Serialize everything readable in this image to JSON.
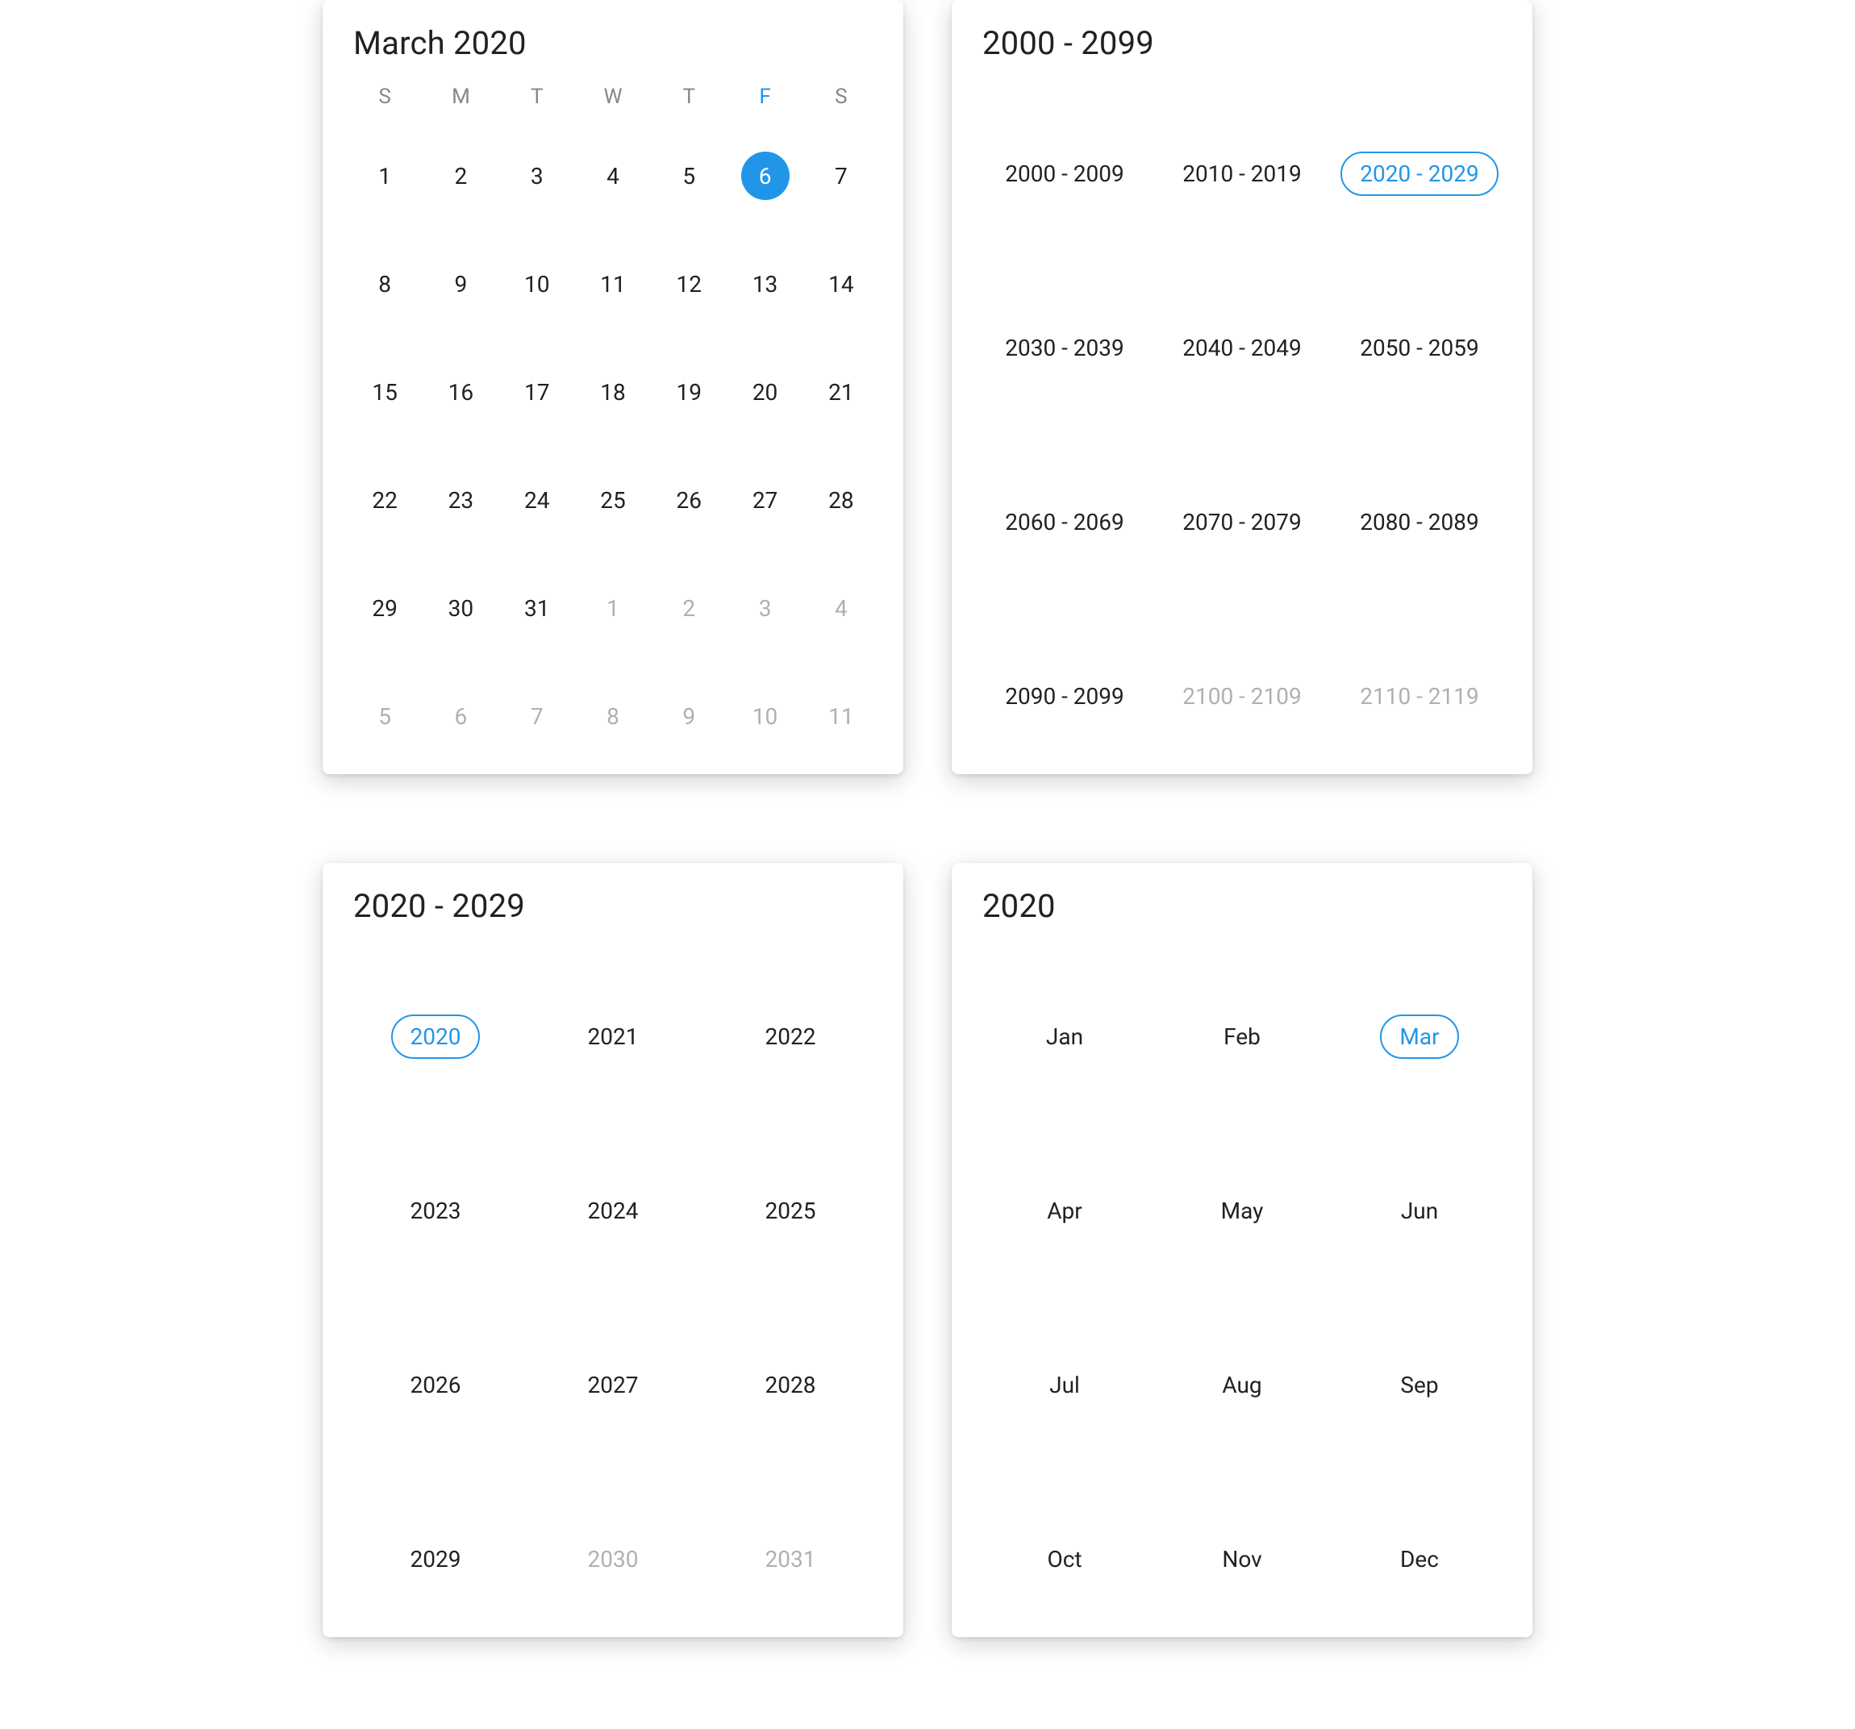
{
  "colors": {
    "accent": "#2196e9",
    "text": "#212121",
    "muted": "#b0b0b0"
  },
  "dayCalendar": {
    "title": "March 2020",
    "weekdays": [
      "S",
      "M",
      "T",
      "W",
      "T",
      "F",
      "S"
    ],
    "highlightWeekdayIndex": 5,
    "selectedDay": 6,
    "days": [
      {
        "n": 1,
        "muted": false
      },
      {
        "n": 2,
        "muted": false
      },
      {
        "n": 3,
        "muted": false
      },
      {
        "n": 4,
        "muted": false
      },
      {
        "n": 5,
        "muted": false
      },
      {
        "n": 6,
        "muted": false
      },
      {
        "n": 7,
        "muted": false
      },
      {
        "n": 8,
        "muted": false
      },
      {
        "n": 9,
        "muted": false
      },
      {
        "n": 10,
        "muted": false
      },
      {
        "n": 11,
        "muted": false
      },
      {
        "n": 12,
        "muted": false
      },
      {
        "n": 13,
        "muted": false
      },
      {
        "n": 14,
        "muted": false
      },
      {
        "n": 15,
        "muted": false
      },
      {
        "n": 16,
        "muted": false
      },
      {
        "n": 17,
        "muted": false
      },
      {
        "n": 18,
        "muted": false
      },
      {
        "n": 19,
        "muted": false
      },
      {
        "n": 20,
        "muted": false
      },
      {
        "n": 21,
        "muted": false
      },
      {
        "n": 22,
        "muted": false
      },
      {
        "n": 23,
        "muted": false
      },
      {
        "n": 24,
        "muted": false
      },
      {
        "n": 25,
        "muted": false
      },
      {
        "n": 26,
        "muted": false
      },
      {
        "n": 27,
        "muted": false
      },
      {
        "n": 28,
        "muted": false
      },
      {
        "n": 29,
        "muted": false
      },
      {
        "n": 30,
        "muted": false
      },
      {
        "n": 31,
        "muted": false
      },
      {
        "n": 1,
        "muted": true
      },
      {
        "n": 2,
        "muted": true
      },
      {
        "n": 3,
        "muted": true
      },
      {
        "n": 4,
        "muted": true
      },
      {
        "n": 5,
        "muted": true
      },
      {
        "n": 6,
        "muted": true
      },
      {
        "n": 7,
        "muted": true
      },
      {
        "n": 8,
        "muted": true
      },
      {
        "n": 9,
        "muted": true
      },
      {
        "n": 10,
        "muted": true
      },
      {
        "n": 11,
        "muted": true
      }
    ]
  },
  "centuryPicker": {
    "title": "2000 - 2099",
    "selected": "2020 - 2029",
    "items": [
      {
        "label": "2000 - 2009",
        "muted": false
      },
      {
        "label": "2010 - 2019",
        "muted": false
      },
      {
        "label": "2020 - 2029",
        "muted": false
      },
      {
        "label": "2030 - 2039",
        "muted": false
      },
      {
        "label": "2040 - 2049",
        "muted": false
      },
      {
        "label": "2050 - 2059",
        "muted": false
      },
      {
        "label": "2060 - 2069",
        "muted": false
      },
      {
        "label": "2070 - 2079",
        "muted": false
      },
      {
        "label": "2080 - 2089",
        "muted": false
      },
      {
        "label": "2090 - 2099",
        "muted": false
      },
      {
        "label": "2100 - 2109",
        "muted": true
      },
      {
        "label": "2110 - 2119",
        "muted": true
      }
    ]
  },
  "decadePicker": {
    "title": "2020 - 2029",
    "selected": "2020",
    "items": [
      {
        "label": "2020",
        "muted": false
      },
      {
        "label": "2021",
        "muted": false
      },
      {
        "label": "2022",
        "muted": false
      },
      {
        "label": "2023",
        "muted": false
      },
      {
        "label": "2024",
        "muted": false
      },
      {
        "label": "2025",
        "muted": false
      },
      {
        "label": "2026",
        "muted": false
      },
      {
        "label": "2027",
        "muted": false
      },
      {
        "label": "2028",
        "muted": false
      },
      {
        "label": "2029",
        "muted": false
      },
      {
        "label": "2030",
        "muted": true
      },
      {
        "label": "2031",
        "muted": true
      }
    ]
  },
  "monthPicker": {
    "title": "2020",
    "selected": "Mar",
    "items": [
      {
        "label": "Jan",
        "muted": false
      },
      {
        "label": "Feb",
        "muted": false
      },
      {
        "label": "Mar",
        "muted": false
      },
      {
        "label": "Apr",
        "muted": false
      },
      {
        "label": "May",
        "muted": false
      },
      {
        "label": "Jun",
        "muted": false
      },
      {
        "label": "Jul",
        "muted": false
      },
      {
        "label": "Aug",
        "muted": false
      },
      {
        "label": "Sep",
        "muted": false
      },
      {
        "label": "Oct",
        "muted": false
      },
      {
        "label": "Nov",
        "muted": false
      },
      {
        "label": "Dec",
        "muted": false
      }
    ]
  }
}
